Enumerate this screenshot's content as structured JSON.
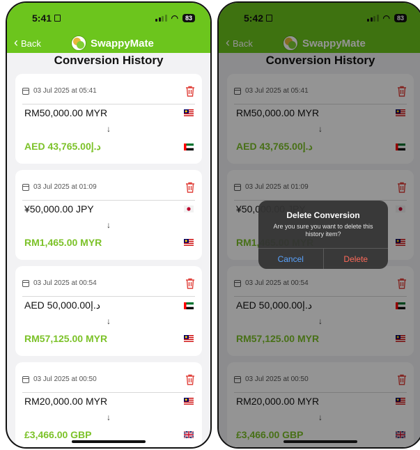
{
  "status": {
    "time_left": "5:41",
    "time_right": "5:42",
    "battery": "83"
  },
  "nav": {
    "back_label": "Back",
    "app_name": "SwappyMate"
  },
  "page": {
    "title": "Conversion History"
  },
  "items": [
    {
      "date": "03 Jul 2025 at 05:41",
      "from": "RM50,000.00 MYR",
      "from_flag": "malaysia-flag-icon",
      "to": "AED 43,765.00د.إ",
      "to_flag": "uae-flag-icon"
    },
    {
      "date": "03 Jul 2025 at 01:09",
      "from": "¥50,000.00 JPY",
      "from_flag": "japan-flag-icon",
      "to": "RM1,465.00 MYR",
      "to_flag": "malaysia-flag-icon"
    },
    {
      "date": "03 Jul 2025 at 00:54",
      "from": "AED 50,000.00د.إ",
      "from_flag": "uae-flag-icon",
      "to": "RM57,125.00 MYR",
      "to_flag": "malaysia-flag-icon"
    },
    {
      "date": "03 Jul 2025 at 00:50",
      "from": "RM20,000.00 MYR",
      "from_flag": "malaysia-flag-icon",
      "to": "£3,466.00 GBP",
      "to_flag": "uk-flag-icon"
    }
  ],
  "dialog": {
    "title": "Delete Conversion",
    "message": "Are you sure you want to delete this history item?",
    "cancel": "Cancel",
    "delete": "Delete"
  },
  "colors": {
    "brand_green": "#6cc51d",
    "amount_green": "#7cc229",
    "trash_red": "#e0413a",
    "cancel_blue": "#5aa4ff",
    "delete_red": "#ff6a5a"
  }
}
